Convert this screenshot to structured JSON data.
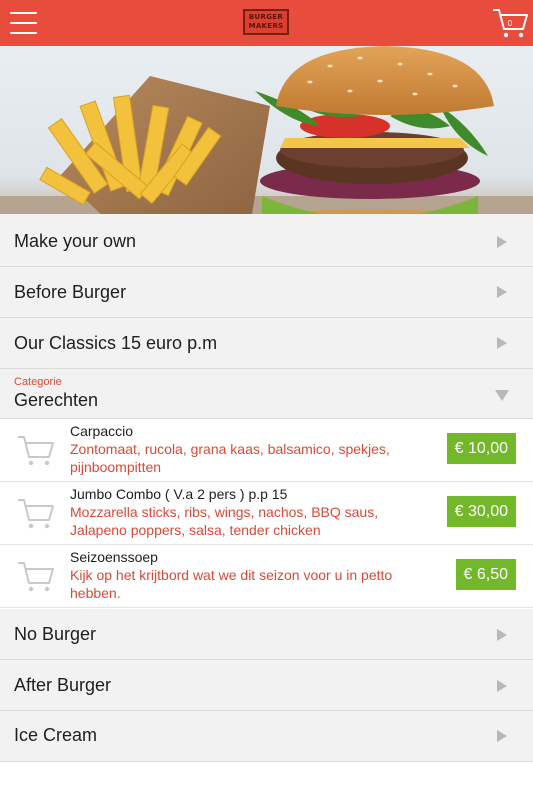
{
  "header": {
    "menu_icon": "hamburger-menu-icon",
    "logo_text": "BURGER MAKERS",
    "cart_icon": "shopping-cart-icon",
    "cart_count": "0",
    "accent_color": "#e84c3d"
  },
  "categories_top": [
    {
      "label": "Make your own"
    },
    {
      "label": "Before Burger"
    },
    {
      "label": "Our Classics 15 euro p.m"
    }
  ],
  "category_select": {
    "caption": "Categorie",
    "value": "Gerechten"
  },
  "items": [
    {
      "name": "Carpaccio",
      "description": "Zontomaat, rucola, grana kaas, balsamico, spekjes, pijnboompitten",
      "price": "€ 10,00"
    },
    {
      "name": "Jumbo Combo ( V.a 2 pers ) p.p 15",
      "description": "Mozzarella sticks, ribs, wings, nachos, BBQ saus, Jalapeno poppers, salsa, tender chicken",
      "price": "€ 30,00"
    },
    {
      "name": "Seizoenssoep",
      "description": "Kijk op het krijtbord wat we dit seizon voor u in petto hebben.",
      "price": "€ 6,50"
    }
  ],
  "categories_bottom": [
    {
      "label": "No Burger"
    },
    {
      "label": "After Burger"
    },
    {
      "label": "Ice Cream"
    }
  ],
  "colors": {
    "header": "#e84c3d",
    "description_text": "#d84a38",
    "price_badge": "#73b72b"
  }
}
